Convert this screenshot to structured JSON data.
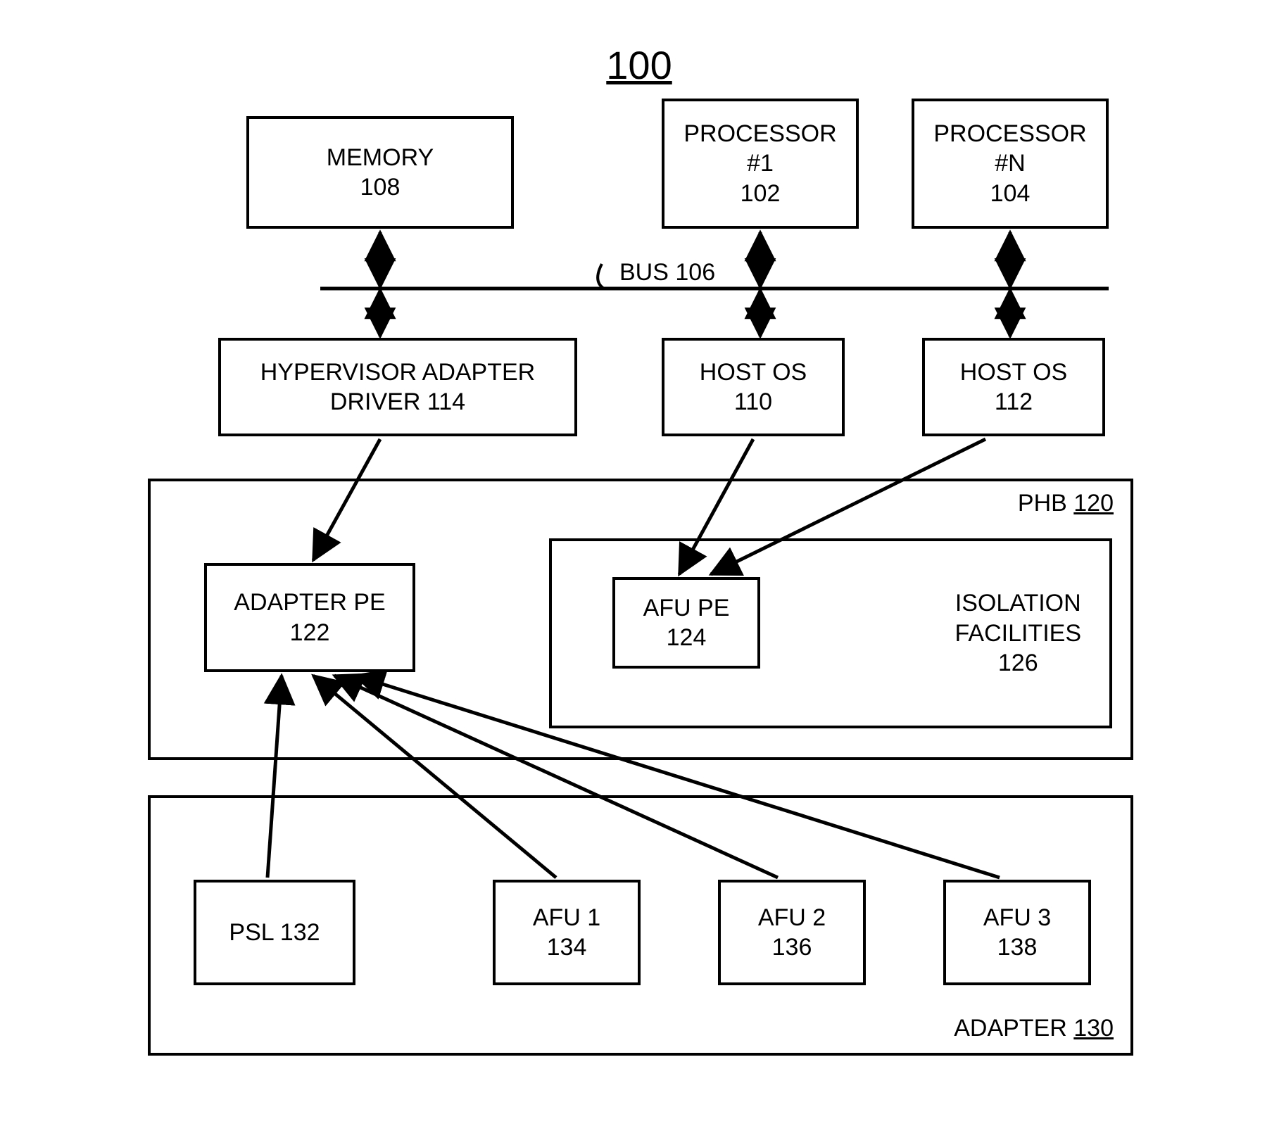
{
  "title": "100",
  "top_row": {
    "memory": {
      "label": "MEMORY",
      "ref": "108"
    },
    "processor1": {
      "label": "PROCESSOR",
      "sub": "#1",
      "ref": "102"
    },
    "processorN": {
      "label": "PROCESSOR",
      "sub": "#N",
      "ref": "104"
    }
  },
  "bus": {
    "label": "BUS",
    "ref": "106"
  },
  "second_row": {
    "hyp_driver": {
      "label": "HYPERVISOR ADAPTER",
      "sub": "DRIVER",
      "ref": "114"
    },
    "host_os_1": {
      "label": "HOST OS",
      "ref": "110"
    },
    "host_os_2": {
      "label": "HOST OS",
      "ref": "112"
    }
  },
  "phb": {
    "label": "PHB",
    "ref": "120",
    "adapter_pe": {
      "label": "ADAPTER PE",
      "ref": "122"
    },
    "isolation": {
      "label": "ISOLATION",
      "sub": "FACILITIES",
      "ref": "126",
      "afu_pe": {
        "label": "AFU PE",
        "ref": "124"
      }
    }
  },
  "adapter": {
    "label": "ADAPTER",
    "ref": "130",
    "psl": {
      "label": "PSL",
      "ref": "132"
    },
    "afu1": {
      "label": "AFU 1",
      "ref": "134"
    },
    "afu2": {
      "label": "AFU 2",
      "ref": "136"
    },
    "afu3": {
      "label": "AFU 3",
      "ref": "138"
    }
  }
}
